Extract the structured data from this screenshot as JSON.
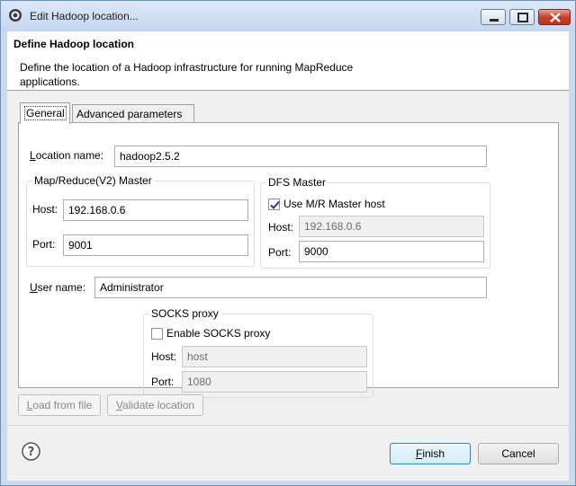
{
  "window": {
    "title": "Edit Hadoop location..."
  },
  "header": {
    "title": "Define Hadoop location",
    "description": "Define the location of a Hadoop infrastructure for running MapReduce applications."
  },
  "tabs": [
    {
      "label": "General",
      "active": true
    },
    {
      "label": "Advanced parameters",
      "active": false
    }
  ],
  "general": {
    "location_name_label_pre": "",
    "location_name_label_mn": "L",
    "location_name_label_post": "ocation name:",
    "location_name_value": "hadoop2.5.2",
    "mr_master": {
      "group_label": "Map/Reduce(V2) Master",
      "host_label": "Host:",
      "host_value": "192.168.0.6",
      "port_label": "Port:",
      "port_value": "9001"
    },
    "dfs_master": {
      "group_label": "DFS Master",
      "use_mr_checkbox_label": "Use M/R Master host",
      "use_mr_checked": true,
      "host_label": "Host:",
      "host_value": "192.168.0.6",
      "port_label": "Port:",
      "port_value": "9000"
    },
    "user_name_label_mn": "U",
    "user_name_label_post": "ser name:",
    "user_name_value": "Administrator",
    "socks": {
      "group_label": "SOCKS proxy",
      "enable_checkbox_label": "Enable SOCKS proxy",
      "enable_checked": false,
      "host_label": "Host:",
      "host_value": "host",
      "port_label": "Port:",
      "port_value": "1080"
    }
  },
  "actions": {
    "load_mn": "L",
    "load_post": "oad from file",
    "validate_mn": "V",
    "validate_post": "alidate location"
  },
  "footer": {
    "finish_mn": "F",
    "finish_post": "inish",
    "cancel_label": "Cancel"
  },
  "colors": {
    "frame": "#c9daee",
    "default_button_border": "#3c7fb1"
  },
  "icons": {
    "app": "eclipse-gear-icon",
    "help": "question-circle-icon"
  }
}
